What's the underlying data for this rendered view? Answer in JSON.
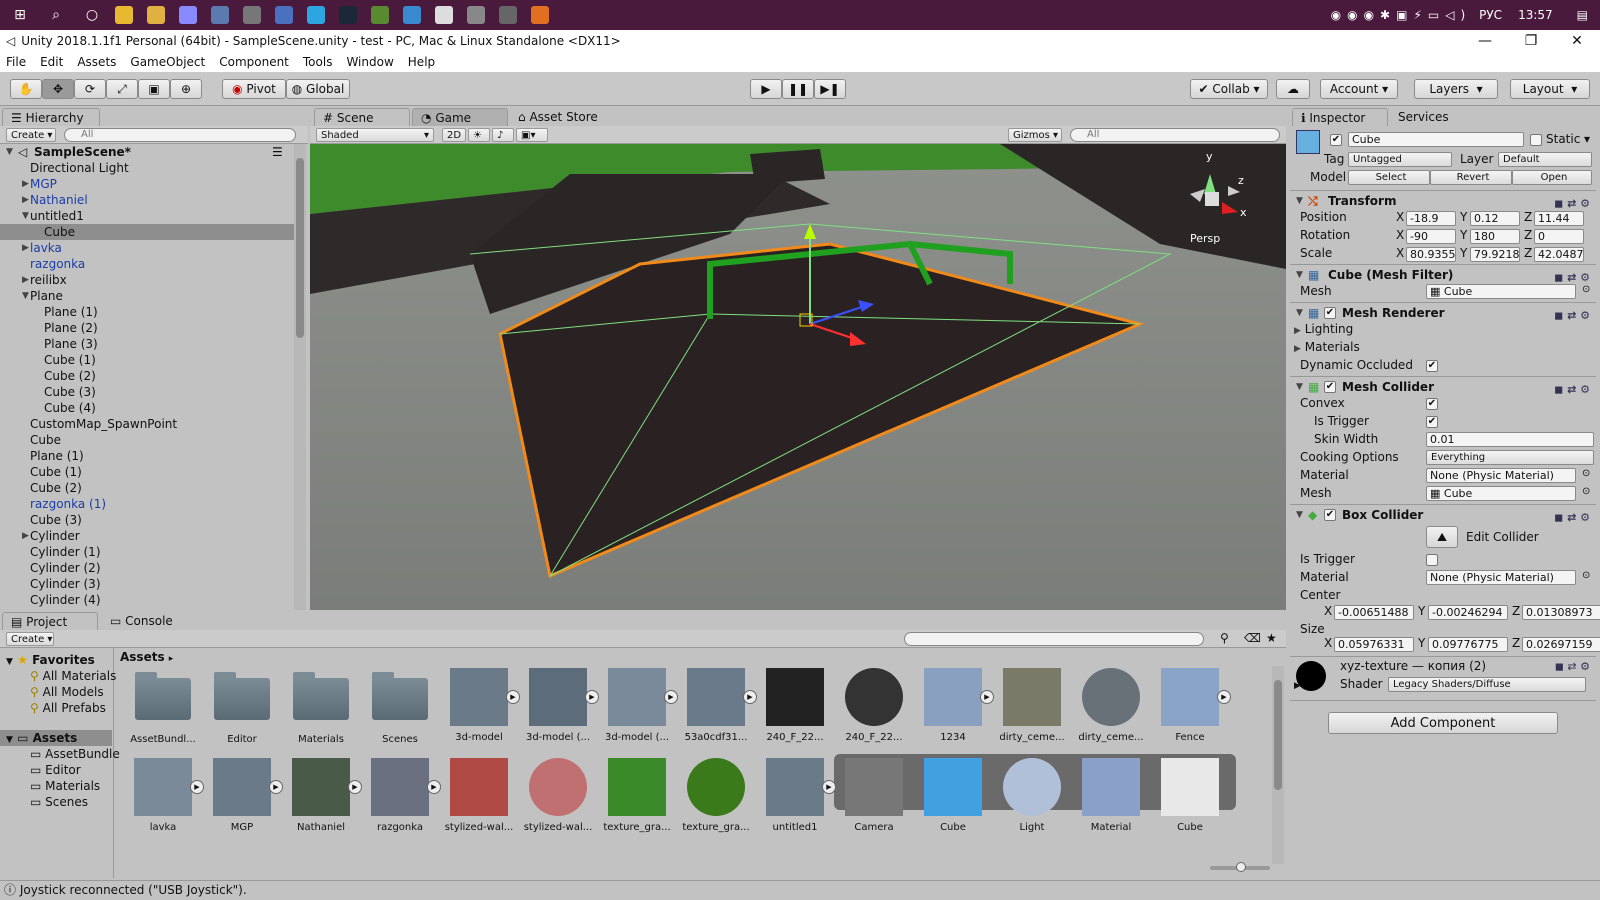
{
  "taskbar": {
    "lang": "РУС",
    "time": "13:57"
  },
  "window": {
    "title": "Unity 2018.1.1f1 Personal (64bit) - SampleScene.unity - test - PC, Mac & Linux Standalone <DX11>"
  },
  "menu": [
    "File",
    "Edit",
    "Assets",
    "GameObject",
    "Component",
    "Tools",
    "Window",
    "Help"
  ],
  "toolbar": {
    "pivot": "Pivot",
    "global": "Global",
    "collab": "Collab",
    "account": "Account",
    "layers": "Layers",
    "layout": "Layout"
  },
  "hierarchy": {
    "tab": "Hierarchy",
    "create": "Create",
    "search": "All",
    "scene": "SampleScene*",
    "items": [
      {
        "label": "Directional Light",
        "indent": 1,
        "blue": false,
        "fold": ""
      },
      {
        "label": "MGP",
        "indent": 1,
        "blue": true,
        "fold": "closed"
      },
      {
        "label": "Nathaniel",
        "indent": 1,
        "blue": true,
        "fold": "closed"
      },
      {
        "label": "untitled1",
        "indent": 1,
        "blue": false,
        "fold": "open"
      },
      {
        "label": "Cube",
        "indent": 2,
        "blue": false,
        "fold": "",
        "sel": true
      },
      {
        "label": "lavka",
        "indent": 1,
        "blue": true,
        "fold": "closed"
      },
      {
        "label": "razgonka",
        "indent": 1,
        "blue": true,
        "fold": ""
      },
      {
        "label": "reilibx",
        "indent": 1,
        "blue": false,
        "fold": "closed"
      },
      {
        "label": "Plane",
        "indent": 1,
        "blue": false,
        "fold": "open"
      },
      {
        "label": "Plane (1)",
        "indent": 2,
        "blue": false,
        "fold": ""
      },
      {
        "label": "Plane (2)",
        "indent": 2,
        "blue": false,
        "fold": ""
      },
      {
        "label": "Plane (3)",
        "indent": 2,
        "blue": false,
        "fold": ""
      },
      {
        "label": "Cube (1)",
        "indent": 2,
        "blue": false,
        "fold": ""
      },
      {
        "label": "Cube (2)",
        "indent": 2,
        "blue": false,
        "fold": ""
      },
      {
        "label": "Cube (3)",
        "indent": 2,
        "blue": false,
        "fold": ""
      },
      {
        "label": "Cube (4)",
        "indent": 2,
        "blue": false,
        "fold": ""
      },
      {
        "label": "CustomMap_SpawnPoint",
        "indent": 1,
        "blue": false,
        "fold": ""
      },
      {
        "label": "Cube",
        "indent": 1,
        "blue": false,
        "fold": ""
      },
      {
        "label": "Plane (1)",
        "indent": 1,
        "blue": false,
        "fold": ""
      },
      {
        "label": "Cube (1)",
        "indent": 1,
        "blue": false,
        "fold": ""
      },
      {
        "label": "Cube (2)",
        "indent": 1,
        "blue": false,
        "fold": ""
      },
      {
        "label": "razgonka (1)",
        "indent": 1,
        "blue": true,
        "fold": ""
      },
      {
        "label": "Cube (3)",
        "indent": 1,
        "blue": false,
        "fold": ""
      },
      {
        "label": "Cylinder",
        "indent": 1,
        "blue": false,
        "fold": "closed"
      },
      {
        "label": "Cylinder (1)",
        "indent": 1,
        "blue": false,
        "fold": ""
      },
      {
        "label": "Cylinder (2)",
        "indent": 1,
        "blue": false,
        "fold": ""
      },
      {
        "label": "Cylinder (3)",
        "indent": 1,
        "blue": false,
        "fold": ""
      },
      {
        "label": "Cylinder (4)",
        "indent": 1,
        "blue": false,
        "fold": ""
      }
    ]
  },
  "scene": {
    "tab_scene": "Scene",
    "tab_game": "Game",
    "tab_store": "Asset Store",
    "shaded": "Shaded",
    "mode2d": "2D",
    "gizmos": "Gizmos",
    "search": "All",
    "persp": "Persp",
    "axis_y": "y",
    "axis_x": "x",
    "axis_z": "z"
  },
  "inspector": {
    "tab": "Inspector",
    "tab2": "Services",
    "name": "Cube",
    "static": "Static",
    "tag_label": "Tag",
    "tag": "Untagged",
    "layer_label": "Layer",
    "layer": "Default",
    "model_label": "Model",
    "select": "Select",
    "revert": "Revert",
    "open": "Open",
    "transform": {
      "title": "Transform",
      "position_label": "Position",
      "rotation_label": "Rotation",
      "scale_label": "Scale",
      "position": [
        "-18.9",
        "0.12",
        "11.44"
      ],
      "rotation": [
        "-90",
        "180",
        "0"
      ],
      "scale": [
        "80.9355",
        "79.9218",
        "42.0487"
      ]
    },
    "mesh_filter": {
      "title": "Cube (Mesh Filter)",
      "mesh_label": "Mesh",
      "mesh": "Cube"
    },
    "mesh_renderer": {
      "title": "Mesh Renderer",
      "lighting": "Lighting",
      "materials": "Materials",
      "dyn": "Dynamic Occluded"
    },
    "mesh_collider": {
      "title": "Mesh Collider",
      "convex": "Convex",
      "trigger": "Is Trigger",
      "skin_label": "Skin Width",
      "skin": "0.01",
      "cooking_label": "Cooking Options",
      "cooking": "Everything",
      "material_label": "Material",
      "material": "None (Physic Material)",
      "mesh_label": "Mesh",
      "mesh": "Cube"
    },
    "box_collider": {
      "title": "Box Collider",
      "edit": "Edit Collider",
      "trigger": "Is Trigger",
      "material_label": "Material",
      "material": "None (Physic Material)",
      "center_label": "Center",
      "center": [
        "-0.00651488",
        "-0.00246294",
        "0.01308973"
      ],
      "size_label": "Size",
      "size": [
        "0.05976331",
        "0.09776775",
        "0.02697159"
      ]
    },
    "material": {
      "name": "xyz-texture — копия (2)",
      "shader_label": "Shader",
      "shader": "Legacy Shaders/Diffuse"
    },
    "add_component": "Add Component"
  },
  "project": {
    "tab": "Project",
    "tab2": "Console",
    "create": "Create",
    "breadcrumb": "Assets",
    "favorites": {
      "title": "Favorites",
      "items": [
        "All Materials",
        "All Models",
        "All Prefabs"
      ]
    },
    "assets_root": {
      "title": "Assets",
      "items": [
        "AssetBundle",
        "Editor",
        "Materials",
        "Scenes"
      ]
    },
    "row1": [
      "AssetBundl...",
      "Editor",
      "Materials",
      "Scenes",
      "3d-model",
      "3d-model (...",
      "3d-model (...",
      "53a0cdf31...",
      "240_F_22...",
      "240_F_22...",
      "1234",
      "dirty_ceme...",
      "dirty_ceme...",
      "Fence"
    ],
    "row2": [
      "lavka",
      "MGP",
      "Nathaniel",
      "razgonka",
      "stylized-wal...",
      "stylized-wal...",
      "texture_gra...",
      "texture_gra...",
      "untitled1",
      "Camera",
      "Cube",
      "Light",
      "Material",
      "Cube"
    ]
  },
  "status": "Joystick reconnected (\"USB Joystick\")."
}
